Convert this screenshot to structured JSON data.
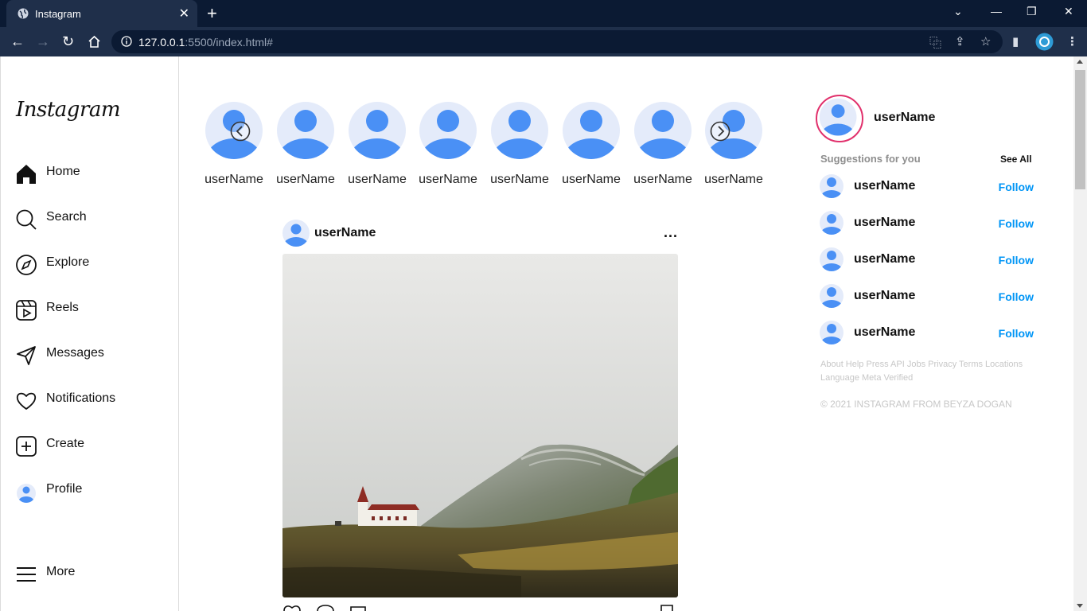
{
  "browser": {
    "tab_title": "Instagram",
    "url_host": "127.0.0.1",
    "url_path": ":5500/index.html#"
  },
  "sidebar": {
    "logo": "Instagram",
    "items": [
      {
        "label": "Home",
        "icon": "home-icon"
      },
      {
        "label": "Search",
        "icon": "search-icon"
      },
      {
        "label": "Explore",
        "icon": "compass-icon"
      },
      {
        "label": "Reels",
        "icon": "reels-icon"
      },
      {
        "label": "Messages",
        "icon": "send-icon"
      },
      {
        "label": "Notifications",
        "icon": "heart-icon"
      },
      {
        "label": "Create",
        "icon": "plus-square-icon"
      },
      {
        "label": "Profile",
        "icon": "avatar-icon"
      }
    ],
    "more_label": "More"
  },
  "stories": [
    "userName",
    "userName",
    "userName",
    "userName",
    "userName",
    "userName",
    "userName",
    "userName"
  ],
  "post": {
    "username": "userName",
    "more": "..."
  },
  "right": {
    "username": "userName",
    "suggestions_title": "Suggestions for you",
    "see_all": "See All",
    "suggestions": [
      {
        "name": "userName",
        "action": "Follow"
      },
      {
        "name": "userName",
        "action": "Follow"
      },
      {
        "name": "userName",
        "action": "Follow"
      },
      {
        "name": "userName",
        "action": "Follow"
      },
      {
        "name": "userName",
        "action": "Follow"
      }
    ],
    "footer_links": "About Help Press API Jobs Privacy Terms Locations Language Meta Verified",
    "copyright": "© 2021 INSTAGRAM FROM BEYZA DOGAN"
  },
  "colors": {
    "avatar_bg": "#e4ebfa",
    "avatar_fg": "#4a90f5",
    "follow": "#0095f6",
    "story_ring": "#e1306c"
  }
}
